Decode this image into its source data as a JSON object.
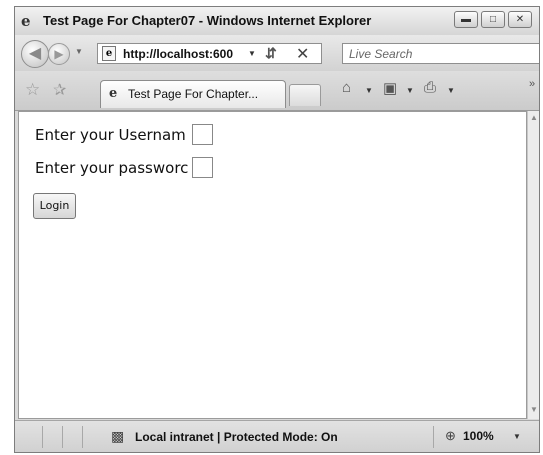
{
  "window": {
    "title": "Test Page For Chapter07 - Windows Internet Explorer",
    "icon": "ie-logo-icon",
    "controls": [
      "minimize-icon",
      "maximize-icon",
      "close-icon"
    ]
  },
  "toolbar": {
    "back_icon": "back-arrow-icon",
    "forward_icon": "forward-arrow-icon",
    "address": "http://localhost:600",
    "search_placeholder": "Live Search"
  },
  "tabs": [
    {
      "label": "Test Page For Chapter...",
      "icon": "ie-logo-icon"
    }
  ],
  "commandbar": {
    "icons": [
      "home-icon",
      "rss-feed-icon",
      "print-icon"
    ]
  },
  "page": {
    "username_label": "Enter your Usernam",
    "password_label": "Enter your passworc",
    "login_button": "Login"
  },
  "status": {
    "zone": "Local intranet | Protected Mode: On",
    "zoom": "100%"
  }
}
